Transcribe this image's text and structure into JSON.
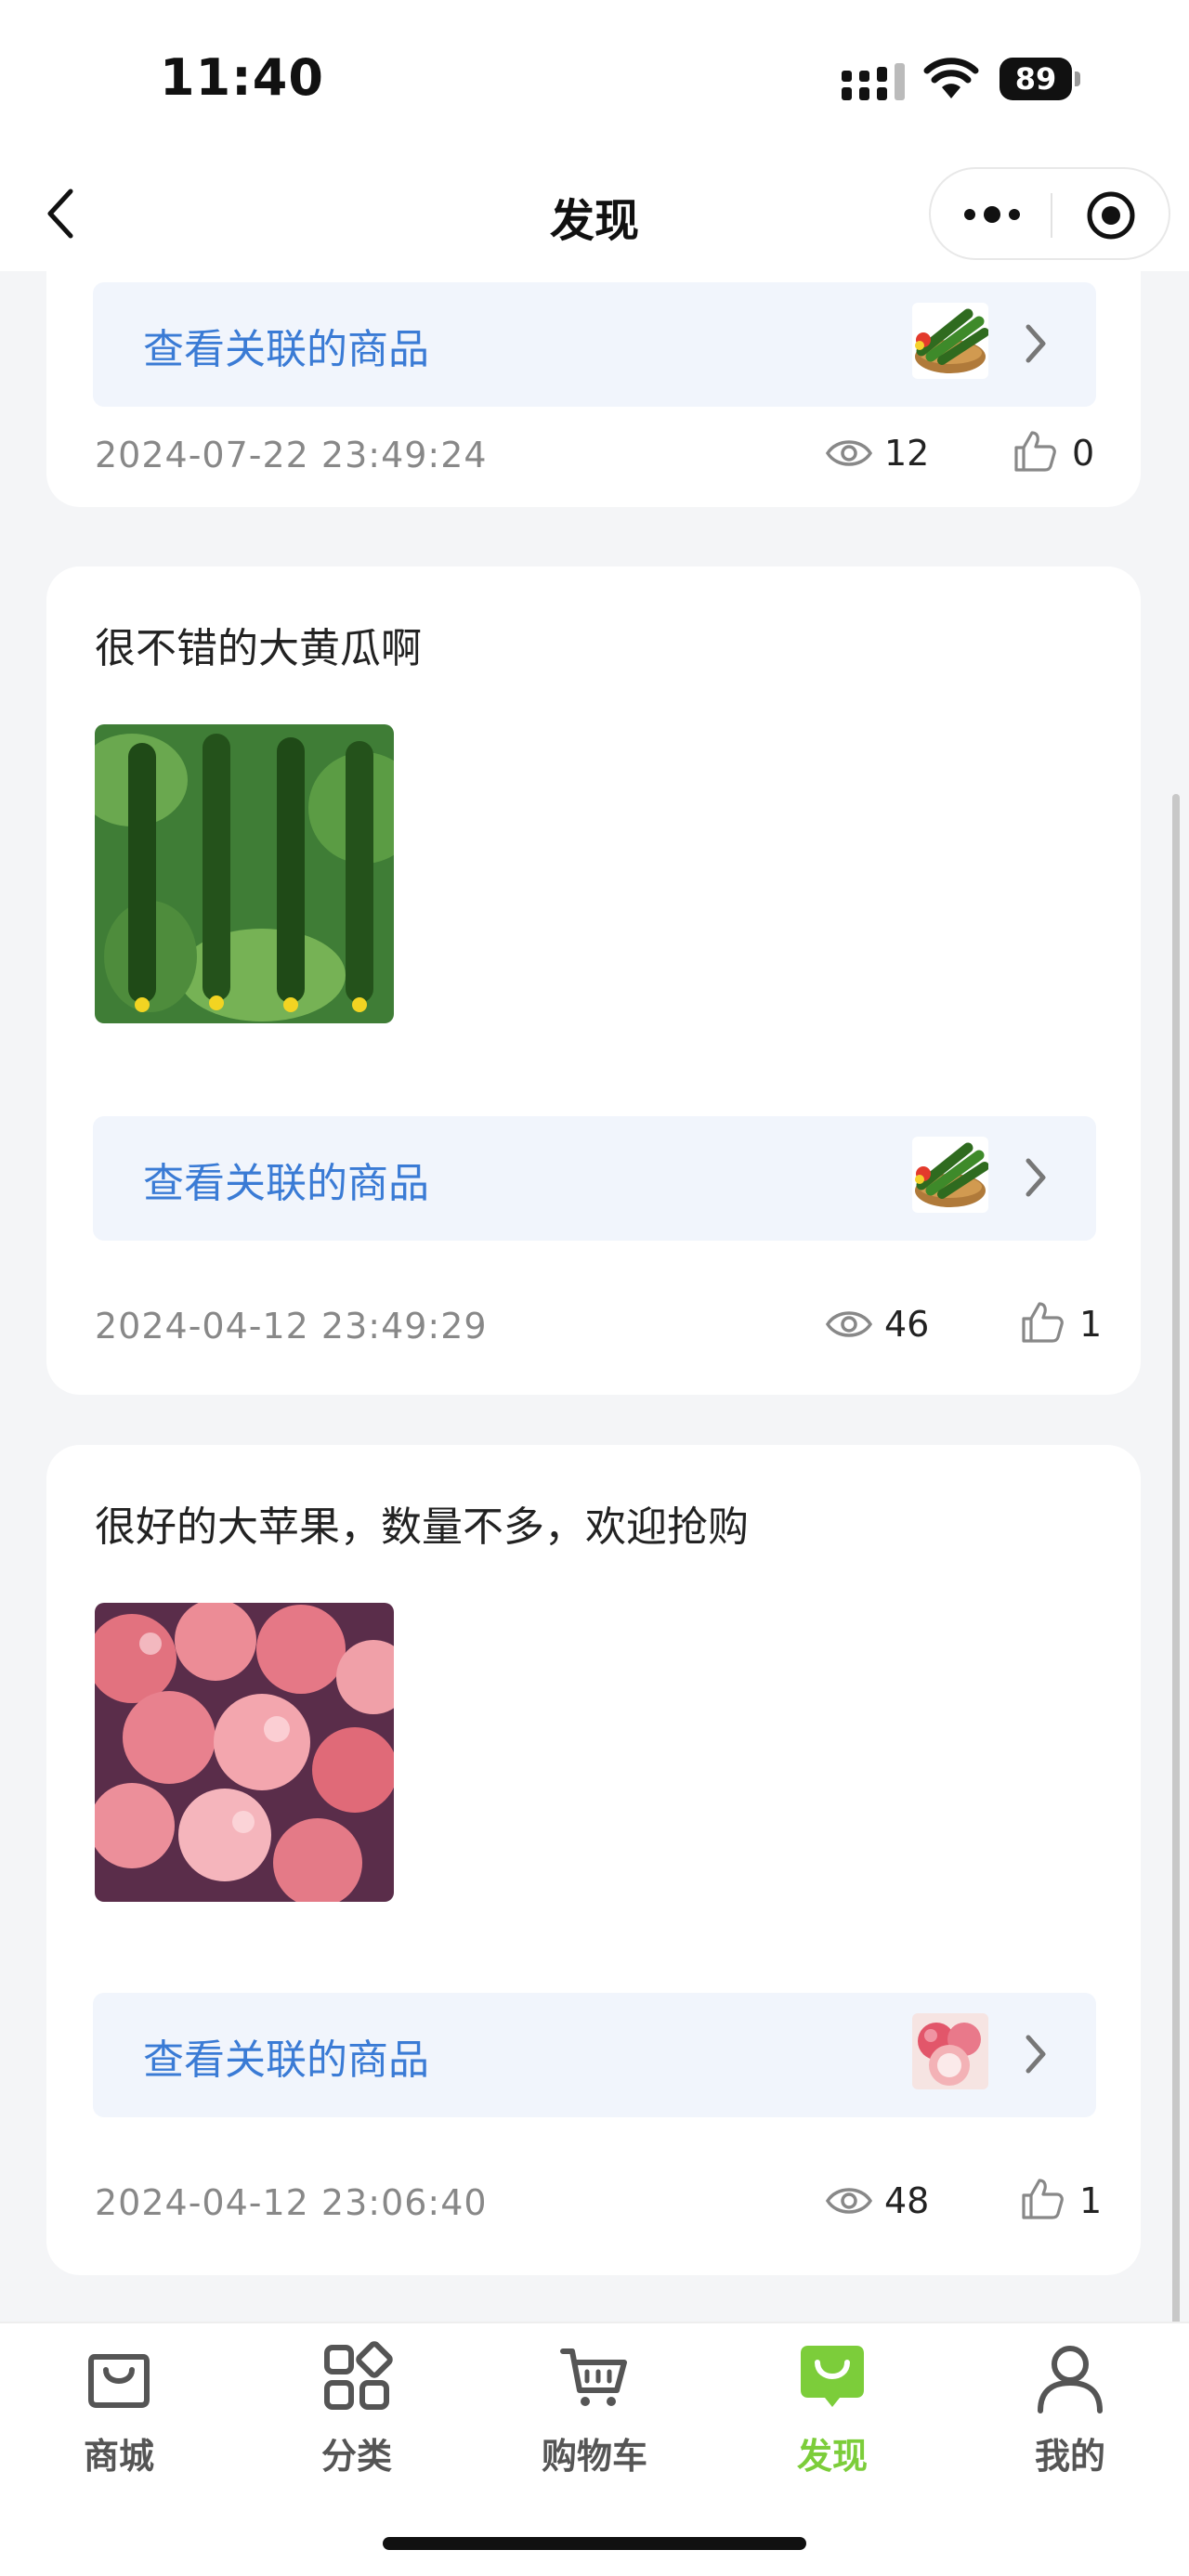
{
  "status_bar": {
    "time": "11:40",
    "battery": "89"
  },
  "nav": {
    "title": "发现"
  },
  "posts": [
    {
      "text": "",
      "link_label": "查看关联的商品",
      "date": "2024-07-22 23:49:24",
      "views": "12",
      "likes": "0",
      "thumb": "cucumber"
    },
    {
      "text": "很不错的大黄瓜啊",
      "image": "cucumber-photo",
      "link_label": "查看关联的商品",
      "date": "2024-04-12 23:49:29",
      "views": "46",
      "likes": "1",
      "thumb": "cucumber"
    },
    {
      "text": "很好的大苹果，数量不多，欢迎抢购",
      "image": "apple-photo",
      "link_label": "查看关联的商品",
      "date": "2024-04-12 23:06:40",
      "views": "48",
      "likes": "1",
      "thumb": "apple"
    }
  ],
  "tabs": [
    {
      "label": "商城",
      "icon": "shopping-bag-icon",
      "active": false
    },
    {
      "label": "分类",
      "icon": "category-grid-icon",
      "active": false
    },
    {
      "label": "购物车",
      "icon": "cart-icon",
      "active": false
    },
    {
      "label": "发现",
      "icon": "discover-icon",
      "active": true
    },
    {
      "label": "我的",
      "icon": "profile-icon",
      "active": false
    }
  ],
  "colors": {
    "accent": "#7ccd3a",
    "link": "#3a7bd5",
    "link_bg": "#f1f5fc",
    "page_bg": "#f4f5f7"
  }
}
